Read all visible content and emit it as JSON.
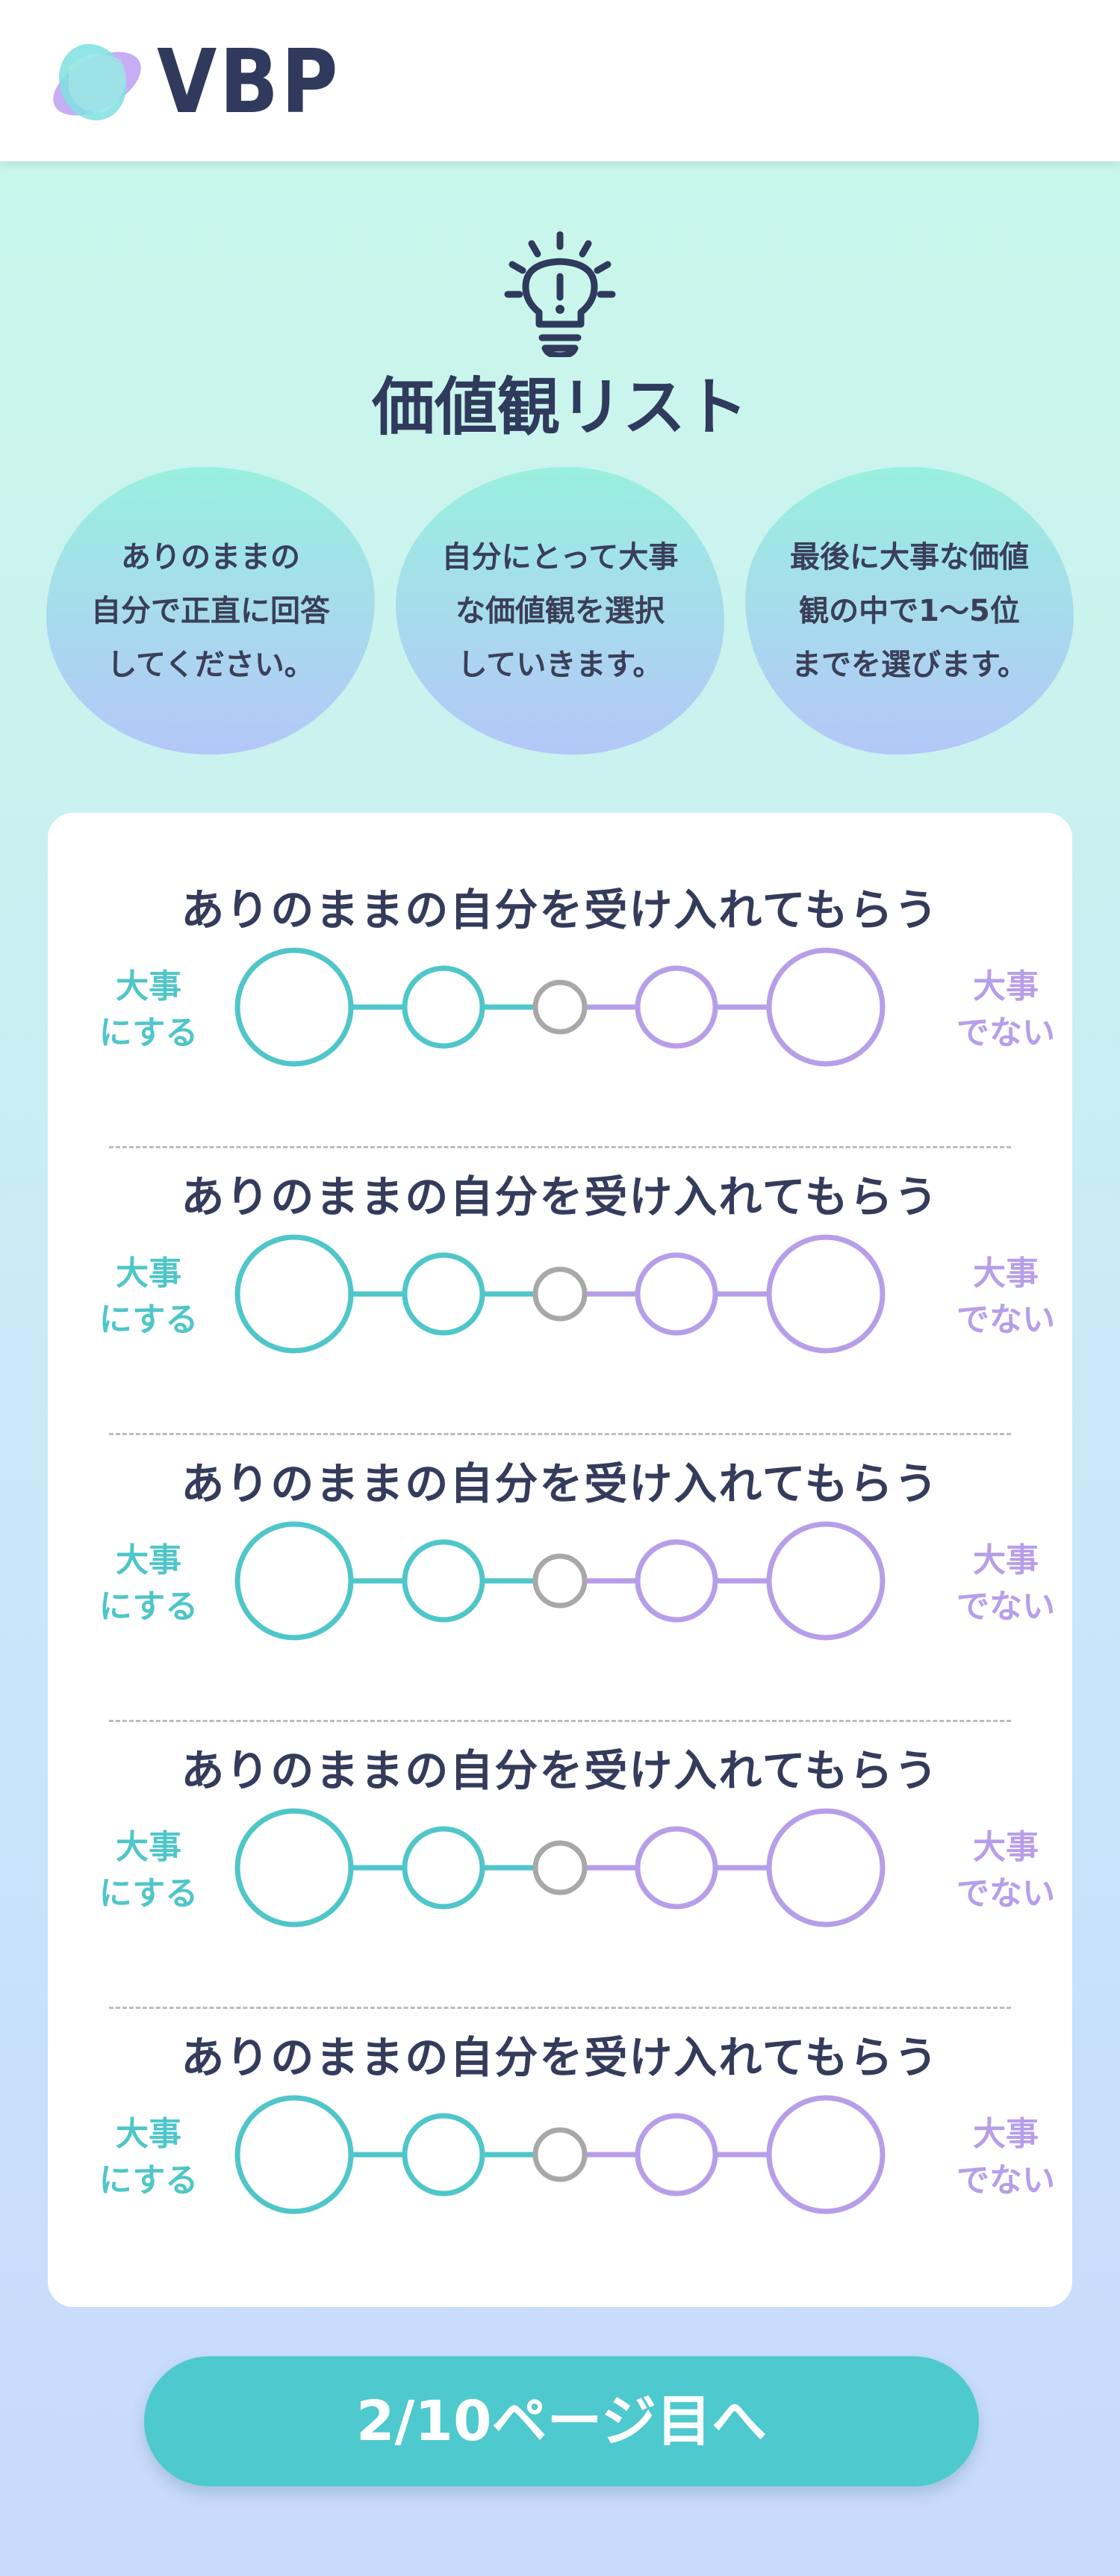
{
  "header": {
    "logo_text": "VBP",
    "colors": {
      "logo_teal": "#7fe0e0",
      "logo_purple": "#c3a9f5",
      "text": "#2f3a5d"
    }
  },
  "hero": {
    "icon": "lightbulb-icon",
    "title": "価値観リスト"
  },
  "steps": [
    {
      "text": "ありのままの\n自分で正直に回答\nしてください。"
    },
    {
      "text": "自分にとって大事\nな価値観を選択\nしていきます。"
    },
    {
      "text": "最後に大事な価値\n観の中で1〜5位\nまでを選びます。"
    }
  ],
  "questions": [
    {
      "text": "ありのままの自分を受け入れてもらう",
      "left_label": "大事\nにする",
      "right_label": "大事\nでない"
    },
    {
      "text": "ありのままの自分を受け入れてもらう",
      "left_label": "大事\nにする",
      "right_label": "大事\nでない"
    },
    {
      "text": "ありのままの自分を受け入れてもらう",
      "left_label": "大事\nにする",
      "right_label": "大事\nでない"
    },
    {
      "text": "ありのままの自分を受け入れてもらう",
      "left_label": "大事\nにする",
      "right_label": "大事\nでない"
    },
    {
      "text": "ありのままの自分を受け入れてもらう",
      "left_label": "大事\nにする",
      "right_label": "大事\nでない"
    }
  ],
  "scale_colors": {
    "agree": "#4fc6c9",
    "neutral": "#a8a8a8",
    "disagree": "#b79ee9"
  },
  "next_button": {
    "label": "2/10ページ目へ",
    "color": "#4ec9cd"
  }
}
